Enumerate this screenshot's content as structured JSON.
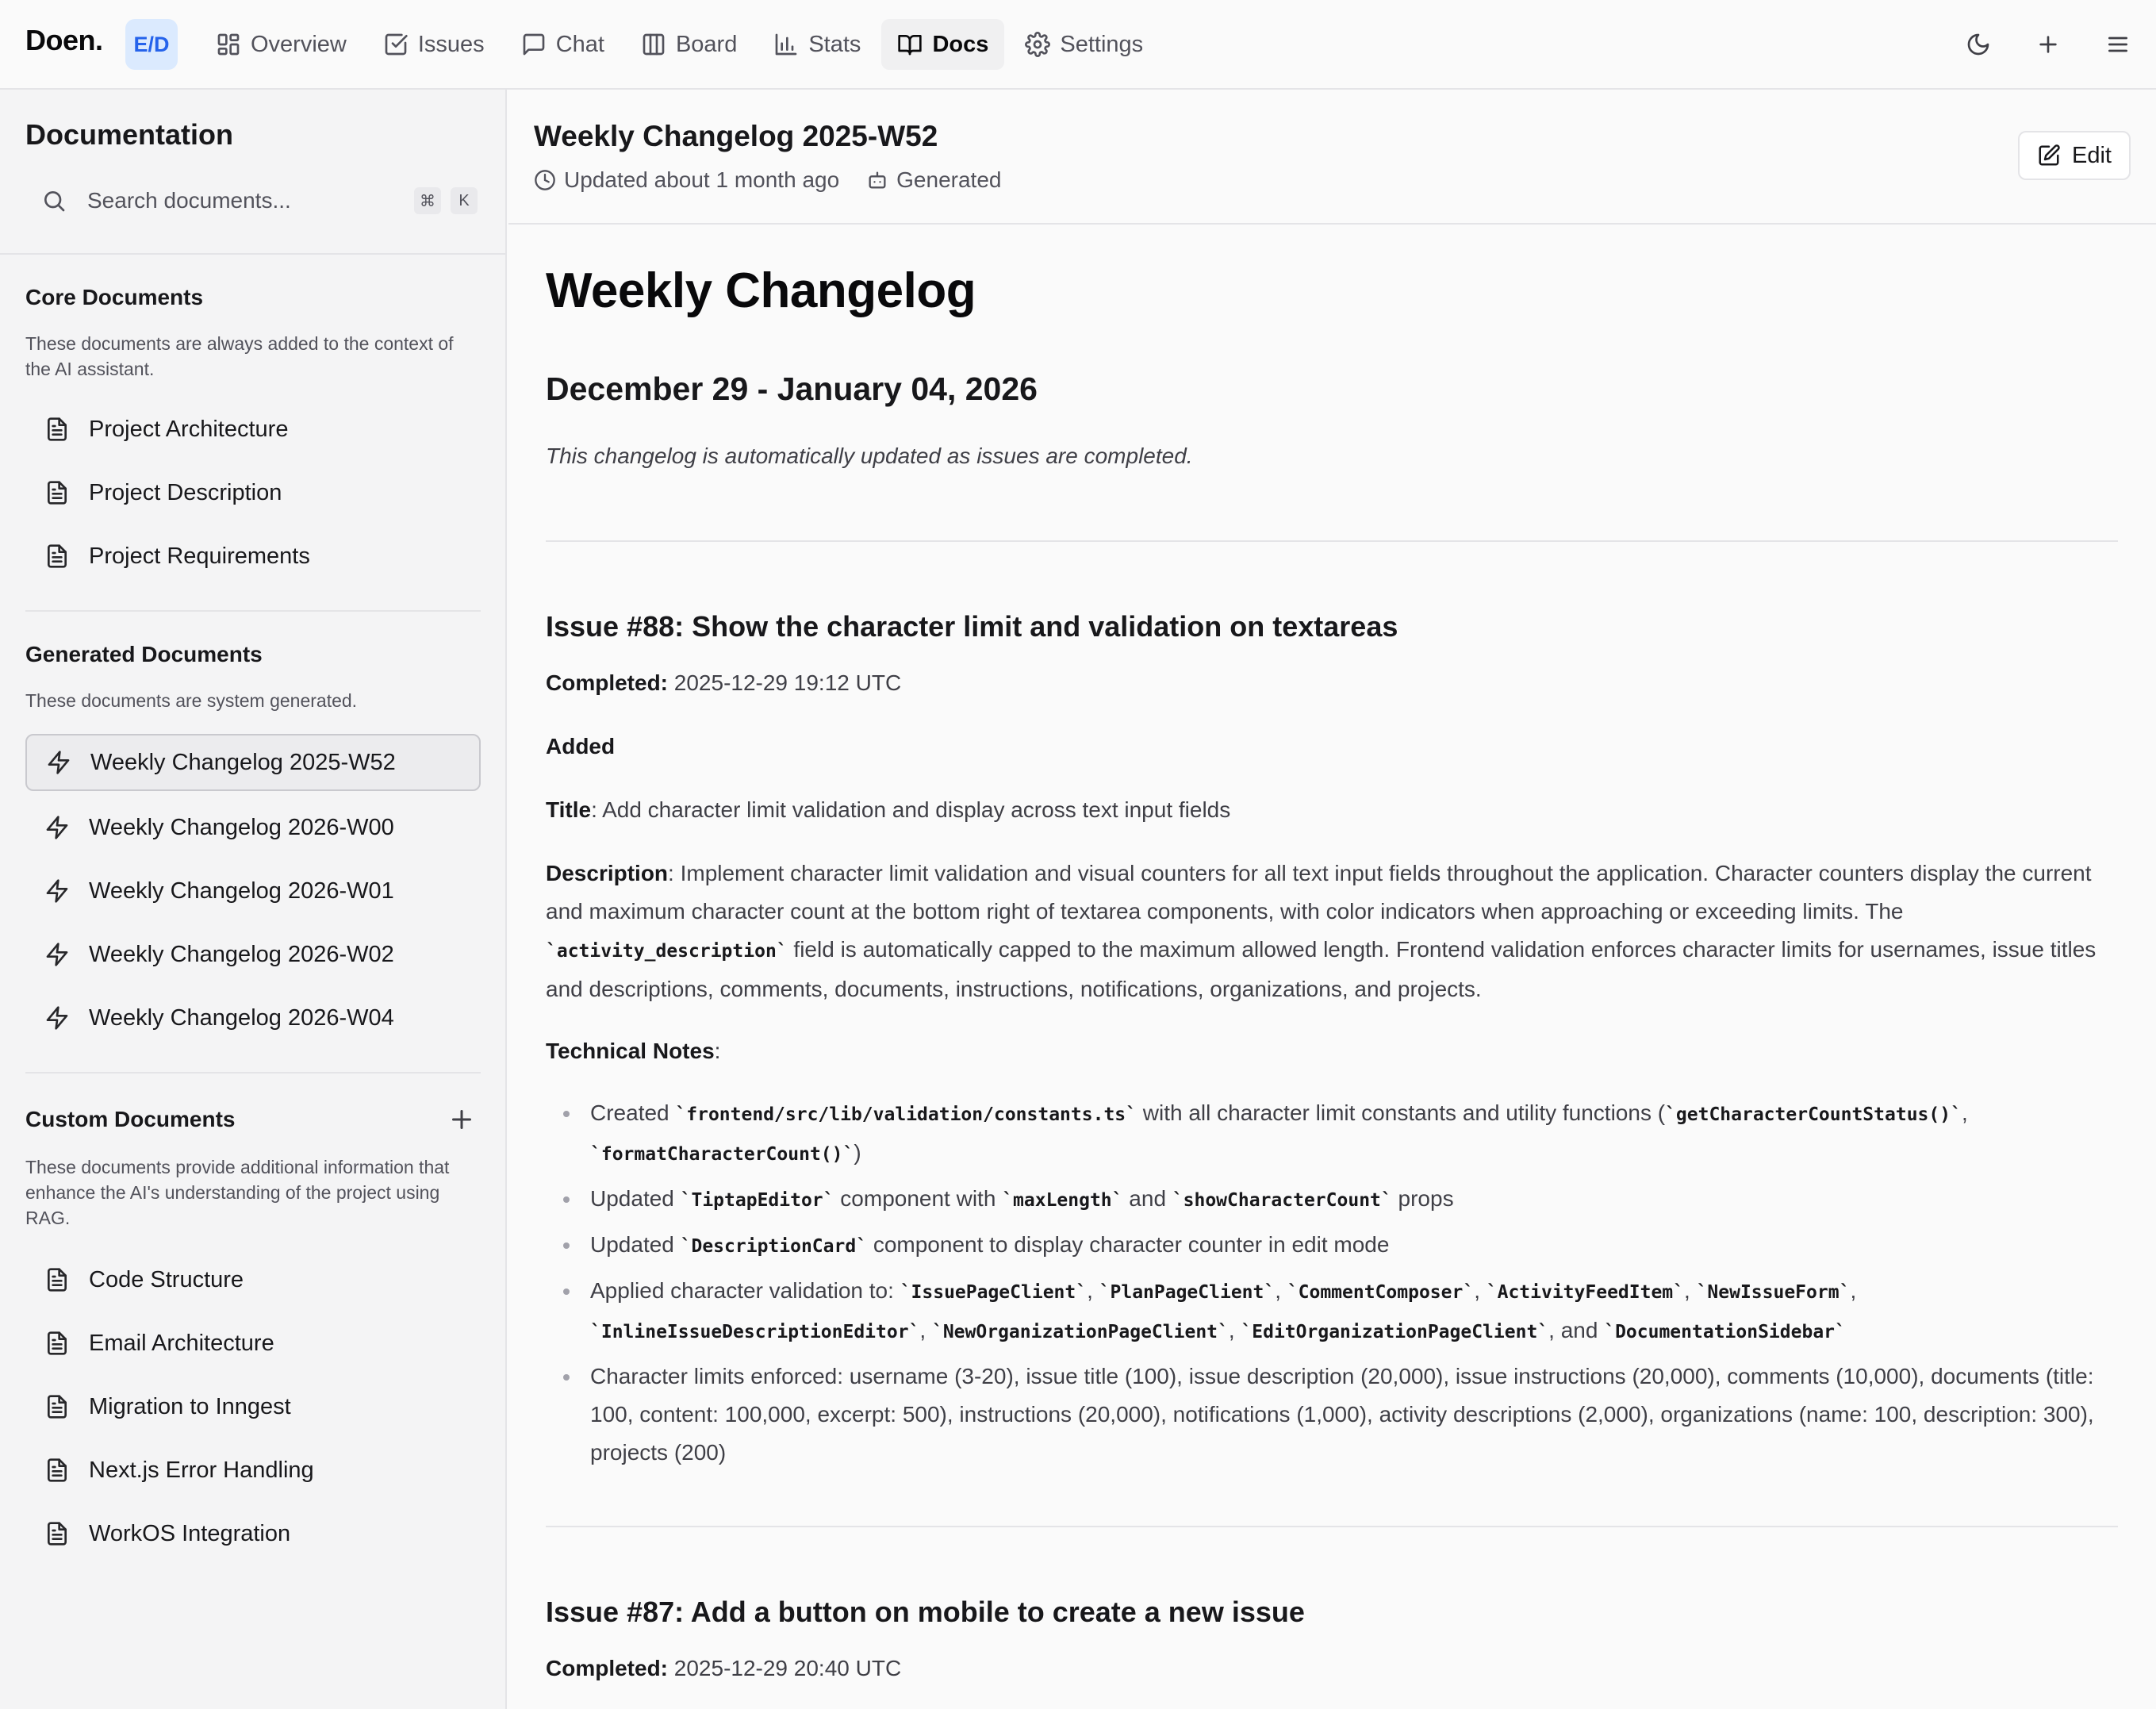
{
  "app": {
    "logo": "Doen.",
    "org_badge": "E/D"
  },
  "nav": [
    {
      "label": "Overview",
      "icon": "layout-grid-icon"
    },
    {
      "label": "Issues",
      "icon": "square-check-icon"
    },
    {
      "label": "Chat",
      "icon": "message-square-icon"
    },
    {
      "label": "Board",
      "icon": "columns-icon"
    },
    {
      "label": "Stats",
      "icon": "bar-chart-icon"
    },
    {
      "label": "Docs",
      "icon": "book-open-icon",
      "active": true
    },
    {
      "label": "Settings",
      "icon": "gear-icon"
    }
  ],
  "top_actions": [
    "moon-icon",
    "plus-icon",
    "menu-icon"
  ],
  "sidebar": {
    "title": "Documentation",
    "search": {
      "placeholder": "Search documents...",
      "kbd": [
        "⌘",
        "K"
      ]
    },
    "core": {
      "title": "Core Documents",
      "desc": "These documents are always added to the context of the AI assistant.",
      "items": [
        "Project Architecture",
        "Project Description",
        "Project Requirements"
      ]
    },
    "generated": {
      "title": "Generated Documents",
      "desc": "These documents are system generated.",
      "items": [
        "Weekly Changelog 2025-W52",
        "Weekly Changelog 2026-W00",
        "Weekly Changelog 2026-W01",
        "Weekly Changelog 2026-W02",
        "Weekly Changelog 2026-W04"
      ],
      "selected": "Weekly Changelog 2025-W52"
    },
    "custom": {
      "title": "Custom Documents",
      "desc": "These documents provide additional information that enhance the AI's understanding of the project using RAG.",
      "items": [
        "Code Structure",
        "Email Architecture",
        "Migration to Inngest",
        "Next.js Error Handling",
        "WorkOS Integration"
      ]
    }
  },
  "doc": {
    "title": "Weekly Changelog 2025-W52",
    "updated": "Updated about 1 month ago",
    "generated": "Generated",
    "edit_label": "Edit",
    "h1": "Weekly Changelog",
    "range": "December 29 - January 04, 2026",
    "note": "This changelog is automatically updated as issues are completed.",
    "issue88": {
      "heading": "Issue #88: Show the character limit and validation on textareas",
      "completed_label": "Completed:",
      "completed": "2025-12-29 19:12 UTC",
      "added": "Added",
      "title_label": "Title",
      "title_text": ": Add character limit validation and display across text input fields",
      "description_label": "Description",
      "desc_part1": ": Implement character limit validation and visual counters for all text input fields throughout the application. Character counters display the current and maximum character count at the bottom right of textarea components, with color indicators when approaching or exceeding limits. The ",
      "desc_code": "`activity_description`",
      "desc_part2": " field is automatically capped to the maximum allowed length. Frontend validation enforces character limits for usernames, issue titles and descriptions, comments, documents, instructions, notifications, organizations, and projects.",
      "tech_label": "Technical Notes",
      "tech_colon": ":",
      "n1_a": "Created ",
      "n1_code1": "`frontend/src/lib/validation/constants.ts`",
      "n1_b": " with all character limit constants and utility functions (",
      "n1_code2": "`getCharacterCountStatus()`",
      "n1_c": ", ",
      "n1_code3": "`formatCharacterCount()`",
      "n1_d": ")",
      "n2_a": "Updated ",
      "n2_code1": "`TiptapEditor`",
      "n2_b": " component with ",
      "n2_code2": "`maxLength`",
      "n2_c": " and ",
      "n2_code3": "`showCharacterCount`",
      "n2_d": " props",
      "n3_a": "Updated ",
      "n3_code1": "`DescriptionCard`",
      "n3_b": " component to display character counter in edit mode",
      "n4_a": "Applied character validation to: ",
      "n4_c1": "`IssuePageClient`",
      "n4_c2": "`PlanPageClient`",
      "n4_c3": "`CommentComposer`",
      "n4_c4": "`ActivityFeedItem`",
      "n4_c5": "`NewIssueForm`",
      "n4_c6": "`InlineIssueDescriptionEditor`",
      "n4_c7": "`NewOrganizationPageClient`",
      "n4_c8": "`EditOrganizationPageClient`",
      "n4_and": ", and ",
      "n4_c9": "`DocumentationSidebar`",
      "n5": "Character limits enforced: username (3-20), issue title (100), issue description (20,000), issue instructions (20,000), comments (10,000), documents (title: 100, content: 100,000, excerpt: 500), instructions (20,000), notifications (1,000), activity descriptions (2,000), organizations (name: 100, description: 300), projects (200)"
    },
    "issue87": {
      "heading": "Issue #87: Add a button on mobile to create a new issue",
      "completed_label": "Completed:",
      "completed": "2025-12-29 20:40 UTC"
    }
  }
}
